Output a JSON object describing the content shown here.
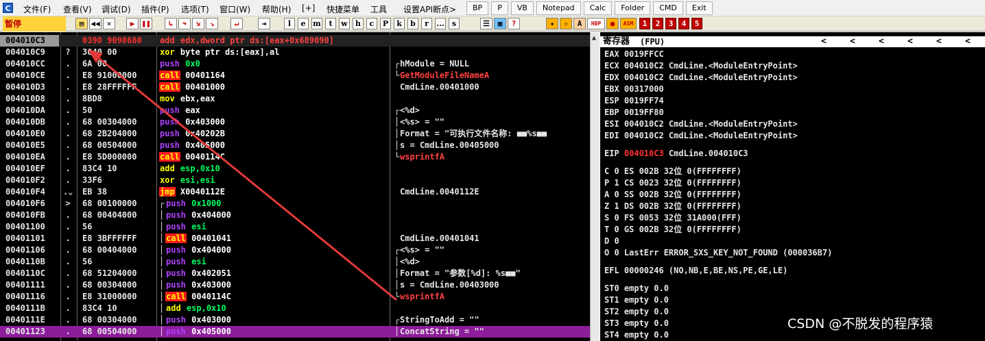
{
  "menu": {
    "app_icon": "C",
    "items": [
      "文件(F)",
      "查看(V)",
      "调试(D)",
      "插件(P)",
      "选项(T)",
      "窗口(W)",
      "帮助(H)",
      "[+]",
      "快捷菜单",
      "工具",
      "设置API断点>"
    ],
    "quick_buttons": [
      "BP",
      "P",
      "VB",
      "Notepad",
      "Calc",
      "Folder",
      "CMD",
      "Exit"
    ]
  },
  "toolbar": {
    "status": "暂停",
    "letters": [
      "l",
      "e",
      "m",
      "t",
      "w",
      "h",
      "c",
      "P",
      "k",
      "b",
      "r",
      "...",
      "s"
    ],
    "numbers": [
      "1",
      "2",
      "3",
      "4",
      "5"
    ],
    "misc": [
      "HBP",
      "ASM"
    ]
  },
  "disasm": {
    "rows": [
      {
        "addr": "004010C3",
        "mark": "",
        "hex": "0390 9098680",
        "hex_red": true,
        "asm_mn": "add",
        "asm_op": "edx,dword ptr ds:[eax+0x689090]",
        "asm_red": true,
        "comment": "",
        "selected": true
      },
      {
        "addr": "004010C9",
        "mark": "?",
        "hex": "3040 00",
        "asm_mn": "xor",
        "asm_op": "byte ptr ds:[eax],al",
        "comment": ""
      },
      {
        "addr": "004010CC",
        "mark": ".",
        "hex": "6A 00",
        "asm_mn": "push",
        "asm_op": "0x0",
        "op_green": true,
        "comment": "hModule = NULL",
        "cbr": "┌"
      },
      {
        "addr": "004010CE",
        "mark": ".",
        "hex": "E8 91000000",
        "asm_mn": "call",
        "asm_op": "00401164",
        "comment": "GetModuleFileNameA",
        "comment_red": true,
        "cbr": "└"
      },
      {
        "addr": "004010D3",
        "mark": ".",
        "hex": "E8 28FFFFFF",
        "asm_mn": "call",
        "asm_op": "00401000",
        "comment": "CmdLine.00401000"
      },
      {
        "addr": "004010D8",
        "mark": ".",
        "hex": "8BD8",
        "asm_mn": "mov",
        "asm_op": "ebx,eax",
        "comment": ""
      },
      {
        "addr": "004010DA",
        "mark": ".",
        "hex": "50",
        "asm_mn": "push",
        "asm_op": "eax",
        "comment": "<%d>",
        "cbr": "┌"
      },
      {
        "addr": "004010DB",
        "mark": ".",
        "hex": "68 00304000",
        "asm_mn": "push",
        "asm_op": "0x403000",
        "comment": "<%s> = \"\"",
        "cbr": "│"
      },
      {
        "addr": "004010E0",
        "mark": ".",
        "hex": "68 2B204000",
        "asm_mn": "push",
        "asm_op": "0x40202B",
        "comment": "Format = \"可执行文件名称: ■■%s■■",
        "cbr": "│"
      },
      {
        "addr": "004010E5",
        "mark": ".",
        "hex": "68 00504000",
        "asm_mn": "push",
        "asm_op": "0x405000",
        "comment": "s = CmdLine.00405000",
        "cbr": "│"
      },
      {
        "addr": "004010EA",
        "mark": ".",
        "hex": "E8 5D000000",
        "asm_mn": "call",
        "asm_op": "0040114C",
        "comment": "wsprintfA",
        "comment_red": true,
        "cbr": "└"
      },
      {
        "addr": "004010EF",
        "mark": ".",
        "hex": "83C4 10",
        "asm_mn": "add",
        "asm_op": "esp,0x10",
        "op_green": true,
        "comment": ""
      },
      {
        "addr": "004010F2",
        "mark": ".",
        "hex": "33F6",
        "asm_mn": "xor",
        "asm_op": "esi,esi",
        "op_green": true,
        "comment": ""
      },
      {
        "addr": "004010F4",
        "mark": ".⌄",
        "hex": "EB 38",
        "asm_mn": "jmp",
        "asm_op": "X0040112E",
        "comment": "CmdLine.0040112E"
      },
      {
        "addr": "004010F6",
        "mark": ">",
        "hex": "68 00100000",
        "br": "┌",
        "asm_mn": "push",
        "asm_op": "0x1000",
        "op_green": true,
        "comment": ""
      },
      {
        "addr": "004010FB",
        "mark": ".",
        "hex": "68 00404000",
        "br": "│",
        "asm_mn": "push",
        "asm_op": "0x404000",
        "comment": ""
      },
      {
        "addr": "00401100",
        "mark": ".",
        "hex": "56",
        "br": "│",
        "asm_mn": "push",
        "asm_op": "esi",
        "op_green": true,
        "comment": ""
      },
      {
        "addr": "00401101",
        "mark": ".",
        "hex": "E8 3BFFFFFF",
        "br": "│",
        "asm_mn": "call",
        "asm_op": "00401041",
        "comment": "CmdLine.00401041"
      },
      {
        "addr": "00401106",
        "mark": ".",
        "hex": "68 00404000",
        "br": "│",
        "asm_mn": "push",
        "asm_op": "0x404000",
        "comment": "<%s> = \"\"",
        "cbr": "┌"
      },
      {
        "addr": "0040110B",
        "mark": ".",
        "hex": "56",
        "br": "│",
        "asm_mn": "push",
        "asm_op": "esi",
        "op_green": true,
        "comment": "<%d>",
        "cbr": "│"
      },
      {
        "addr": "0040110C",
        "mark": ".",
        "hex": "68 51204000",
        "br": "│",
        "asm_mn": "push",
        "asm_op": "0x402051",
        "comment": "Format = \"参数[%d]: %s■■\"",
        "cbr": "│"
      },
      {
        "addr": "00401111",
        "mark": ".",
        "hex": "68 00304000",
        "br": "│",
        "asm_mn": "push",
        "asm_op": "0x403000",
        "comment": "s = CmdLine.00403000",
        "cbr": "│"
      },
      {
        "addr": "00401116",
        "mark": ".",
        "hex": "E8 31000000",
        "br": "│",
        "asm_mn": "call",
        "asm_op": "0040114C",
        "comment": "wsprintfA",
        "comment_red": true,
        "cbr": "└"
      },
      {
        "addr": "0040111B",
        "mark": ".",
        "hex": "83C4 10",
        "br": "│",
        "asm_mn": "add",
        "asm_op": "esp,0x10",
        "op_green": true,
        "comment": ""
      },
      {
        "addr": "0040111E",
        "mark": ".",
        "hex": "68 00304000",
        "br": "│",
        "asm_mn": "push",
        "asm_op": "0x403000",
        "comment": "StringToAdd = \"\"",
        "cbr": "┌"
      },
      {
        "addr": "00401123",
        "mark": ".",
        "hex": "68 00504000",
        "br": "│",
        "asm_mn": "push",
        "asm_op": "0x405000",
        "comment": "ConcatString = \"\"",
        "cbr": "│",
        "purple": true
      }
    ]
  },
  "registers": {
    "title": "寄存器",
    "mode": "(FPU)",
    "nav": [
      "<",
      "<",
      "<",
      "<",
      "<",
      "<"
    ],
    "lines": [
      {
        "t": "EAX 0019FFCC"
      },
      {
        "t": "ECX 004010C2 CmdLine.<ModuleEntryPoint>"
      },
      {
        "t": "EDX 004010C2 CmdLine.<ModuleEntryPoint>"
      },
      {
        "t": "EBX 00317000"
      },
      {
        "t": "ESP 0019FF74"
      },
      {
        "t": "EBP 0019FF80"
      },
      {
        "t": "ESI 004010C2 CmdLine.<ModuleEntryPoint>"
      },
      {
        "t": "EDI 004010C2 CmdLine.<ModuleEntryPoint>"
      },
      {
        "gap": true
      },
      {
        "eip": true,
        "a": "EIP ",
        "b": "004010C3",
        "c": " CmdLine.004010C3"
      },
      {
        "gap": true
      },
      {
        "t": "C 0   ES 002B 32位 0(FFFFFFFF)"
      },
      {
        "t": "P 1   CS 0023 32位 0(FFFFFFFF)"
      },
      {
        "t": "A 0   SS 002B 32位 0(FFFFFFFF)"
      },
      {
        "t": "Z 1   DS 002B 32位 0(FFFFFFFF)"
      },
      {
        "t": "S 0   FS 0053 32位 31A000(FFF)"
      },
      {
        "t": "T 0   GS 002B 32位 0(FFFFFFFF)"
      },
      {
        "t": "D 0"
      },
      {
        "t": "O 0   LastErr ERROR_SXS_KEY_NOT_FOUND (000036B7)"
      },
      {
        "gap": true
      },
      {
        "t": "EFL 00000246 (NO,NB,E,BE,NS,PE,GE,LE)"
      },
      {
        "gap": true
      },
      {
        "t": "ST0 empty 0.0"
      },
      {
        "t": "ST1 empty 0.0"
      },
      {
        "t": "ST2 empty 0.0"
      },
      {
        "t": "ST3 empty 0.0"
      },
      {
        "t": "ST4 empty 0.0"
      }
    ]
  },
  "watermark": "CSDN @不脱发的程序猿",
  "colors": {
    "annotation_arrow": "#e23a3a",
    "selected_row": "#9a9a9a",
    "current_row": "#8d1e9a"
  }
}
